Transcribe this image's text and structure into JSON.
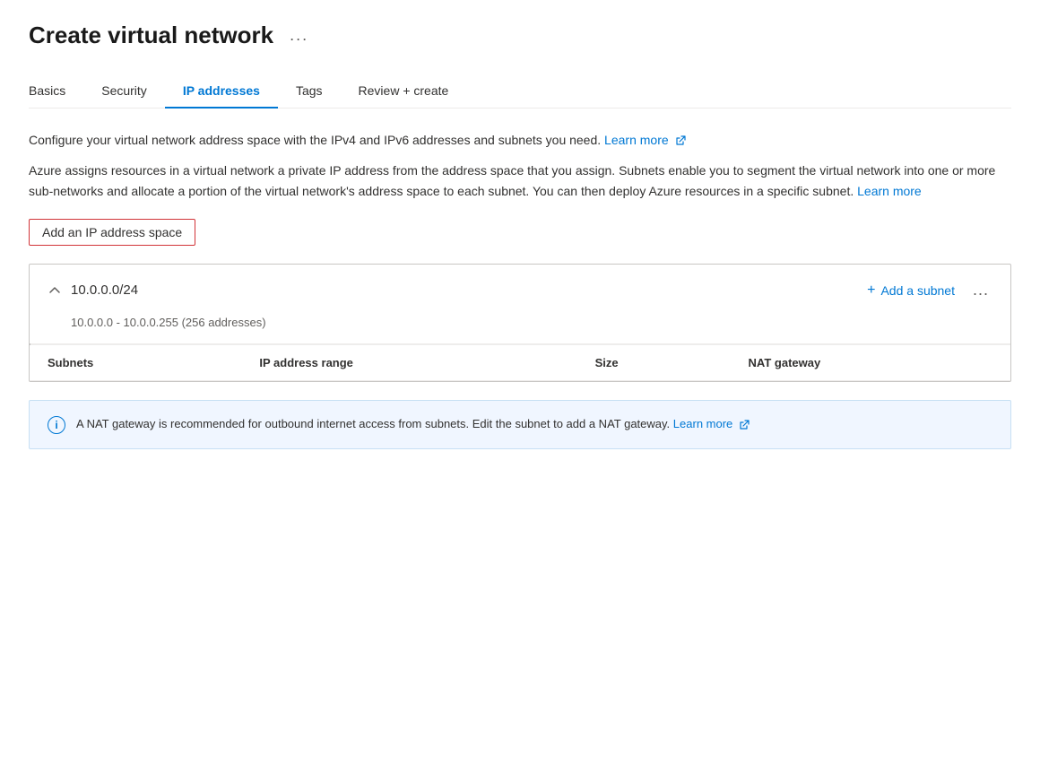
{
  "header": {
    "title": "Create virtual network",
    "ellipsis": "..."
  },
  "tabs": [
    {
      "id": "basics",
      "label": "Basics",
      "active": false
    },
    {
      "id": "security",
      "label": "Security",
      "active": false
    },
    {
      "id": "ip-addresses",
      "label": "IP addresses",
      "active": true
    },
    {
      "id": "tags",
      "label": "Tags",
      "active": false
    },
    {
      "id": "review-create",
      "label": "Review + create",
      "active": false
    }
  ],
  "description": {
    "line1": "Configure your virtual network address space with the IPv4 and IPv6 addresses and subnets you need.",
    "learn_more_1": "Learn more",
    "line2": "Azure assigns resources in a virtual network a private IP address from the address space that you assign. Subnets enable you to segment the virtual network into one or more sub-networks and allocate a portion of the virtual network's address space to each subnet. You can then deploy Azure resources in a specific subnet.",
    "learn_more_2": "Learn more"
  },
  "add_ip_button": "Add an IP address space",
  "ip_space": {
    "address": "10.0.0.0/24",
    "range": "10.0.0.0 - 10.0.0.255 (256 addresses)",
    "add_subnet_label": "Add a subnet",
    "more_options": "...",
    "table": {
      "columns": [
        "Subnets",
        "IP address range",
        "Size",
        "NAT gateway"
      ],
      "rows": []
    }
  },
  "nat_banner": {
    "text": "A NAT gateway is recommended for outbound internet access from subnets. Edit the subnet to add a NAT gateway.",
    "learn_more": "Learn more"
  }
}
